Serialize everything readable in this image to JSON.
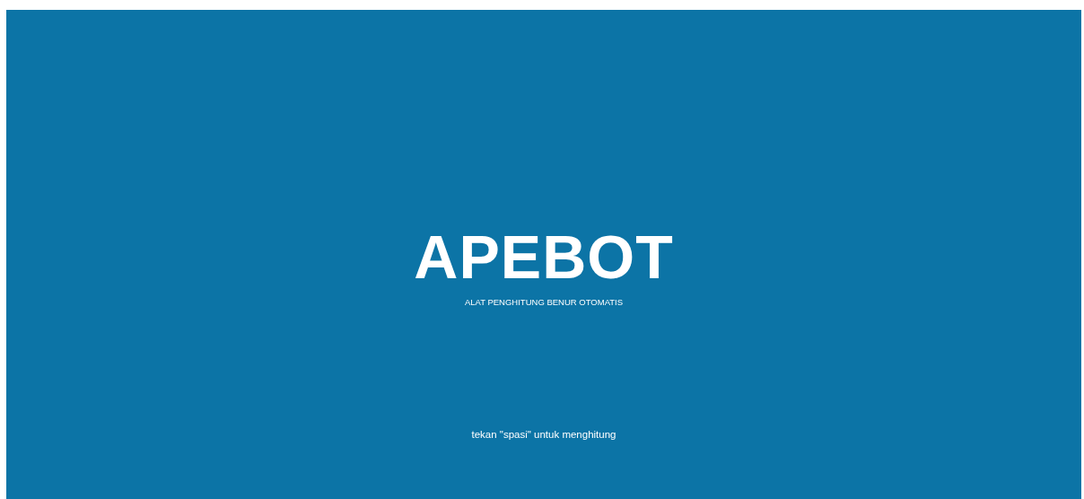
{
  "splash": {
    "title": "APEBOT",
    "subtitle": "ALAT PENGHITUNG BENUR OTOMATIS",
    "hint": "tekan \"spasi\" untuk menghitung"
  }
}
